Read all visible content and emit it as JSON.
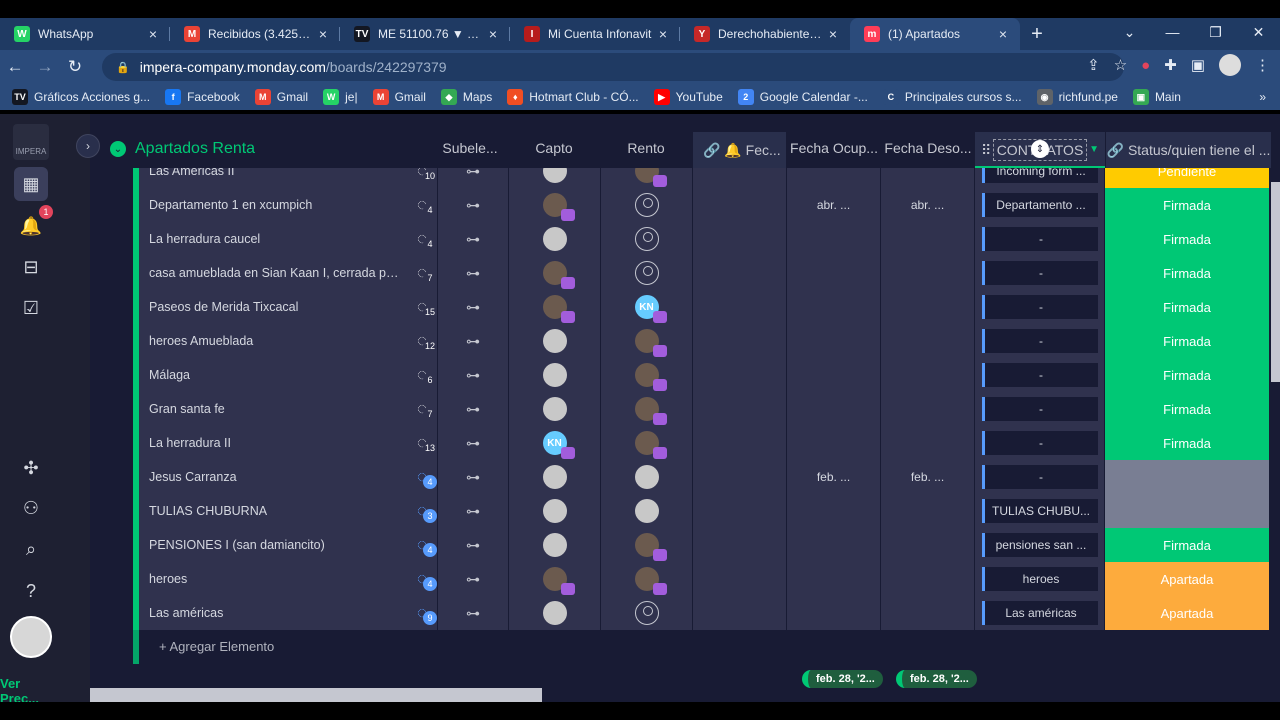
{
  "browser": {
    "tabs": [
      {
        "label": "WhatsApp",
        "icon": "whatsapp-icon",
        "color": "#25d366",
        "glyph": "W"
      },
      {
        "label": "Recibidos (3.425) - jor",
        "icon": "gmail-icon",
        "color": "#ea4335",
        "glyph": "M"
      },
      {
        "label": "ME 51100.76 ▼ −1.52",
        "icon": "tradingview-icon",
        "color": "#131722",
        "glyph": "TV"
      },
      {
        "label": "Mi Cuenta Infonavit",
        "icon": "infonavit-icon",
        "color": "#b71c1c",
        "glyph": "I"
      },
      {
        "label": "Derechohabientes | In",
        "icon": "infonavit-icon",
        "color": "#c62828",
        "glyph": "Y"
      },
      {
        "label": "(1) Apartados",
        "icon": "monday-icon",
        "color": "#ff3d57",
        "glyph": "m"
      }
    ],
    "url_host": "impera-company.monday.com",
    "url_path": "/boards/242297379",
    "bookmarks": [
      {
        "label": "Gráficos Acciones g...",
        "color": "#131722",
        "glyph": "TV"
      },
      {
        "label": "Facebook",
        "color": "#1877f2",
        "glyph": "f"
      },
      {
        "label": "Gmail",
        "color": "#ea4335",
        "glyph": "M"
      },
      {
        "label": "je|",
        "color": "#25d366",
        "glyph": "W"
      },
      {
        "label": "Gmail",
        "color": "#ea4335",
        "glyph": "M"
      },
      {
        "label": "Maps",
        "color": "#34a853",
        "glyph": "◆"
      },
      {
        "label": "Hotmart Club - CÓ...",
        "color": "#f04e23",
        "glyph": "♦"
      },
      {
        "label": "YouTube",
        "color": "#ff0000",
        "glyph": "▶"
      },
      {
        "label": "Google Calendar -...",
        "color": "#4285f4",
        "glyph": "2"
      },
      {
        "label": "Principales cursos s...",
        "color": "#2b4b7b",
        "glyph": "C"
      },
      {
        "label": "richfund.pe",
        "color": "#5f6368",
        "glyph": "◉"
      },
      {
        "label": "Main",
        "color": "#34a853",
        "glyph": "▣"
      }
    ]
  },
  "rail": {
    "logo_text": "IMPERA",
    "notif_count": "1",
    "ver_prec": "Ver Prec..."
  },
  "board": {
    "group_title": "Apartados Renta",
    "columns": {
      "subelementos": "Subele...",
      "capto": "Capto",
      "rento": "Rento",
      "fec": "Fec...",
      "fecha_ocup": "Fecha Ocup...",
      "fecha_deso": "Fecha Deso...",
      "contratos": "CONTRATOS",
      "status": "Status/quien tiene el ..."
    },
    "rows": [
      {
        "name": "Las Americas II",
        "updates": "10",
        "blue": false,
        "capto": "gray",
        "rento": "dark",
        "fecha_ocup": "",
        "fecha_deso": "",
        "contrato": "Incoming form ...",
        "status": "Pendiente",
        "status_class": "st-pendiente"
      },
      {
        "name": "Departamento 1 en xcumpich",
        "updates": "4",
        "blue": false,
        "capto": "dark",
        "rento": "empty",
        "fecha_ocup": "abr. ...",
        "fecha_deso": "abr. ...",
        "contrato": "Departamento ...",
        "status": "Firmada",
        "status_class": "st-firmada"
      },
      {
        "name": "La herradura caucel",
        "updates": "4",
        "blue": false,
        "capto": "gray",
        "rento": "empty",
        "fecha_ocup": "",
        "fecha_deso": "",
        "contrato": "-",
        "status": "Firmada",
        "status_class": "st-firmada"
      },
      {
        "name": "casa amueblada en Sian Kaan I, cerrada pa...",
        "updates": "7",
        "blue": false,
        "capto": "dark",
        "rento": "empty",
        "fecha_ocup": "",
        "fecha_deso": "",
        "contrato": "-",
        "status": "Firmada",
        "status_class": "st-firmada"
      },
      {
        "name": "Paseos de Merida Tixcacal",
        "updates": "15",
        "blue": false,
        "capto": "dark",
        "rento": "kn",
        "fecha_ocup": "",
        "fecha_deso": "",
        "contrato": "-",
        "status": "Firmada",
        "status_class": "st-firmada"
      },
      {
        "name": "heroes Amueblada",
        "updates": "12",
        "blue": false,
        "capto": "gray",
        "rento": "dark",
        "fecha_ocup": "",
        "fecha_deso": "",
        "contrato": "-",
        "status": "Firmada",
        "status_class": "st-firmada"
      },
      {
        "name": "Málaga",
        "updates": "6",
        "blue": false,
        "capto": "gray",
        "rento": "dark",
        "fecha_ocup": "",
        "fecha_deso": "",
        "contrato": "-",
        "status": "Firmada",
        "status_class": "st-firmada"
      },
      {
        "name": "Gran santa fe",
        "updates": "7",
        "blue": false,
        "capto": "gray",
        "rento": "dark",
        "fecha_ocup": "",
        "fecha_deso": "",
        "contrato": "-",
        "status": "Firmada",
        "status_class": "st-firmada"
      },
      {
        "name": "La herradura II",
        "updates": "13",
        "blue": false,
        "capto": "kn",
        "rento": "dark",
        "fecha_ocup": "",
        "fecha_deso": "",
        "contrato": "-",
        "status": "Firmada",
        "status_class": "st-firmada"
      },
      {
        "name": "Jesus Carranza",
        "updates": "4",
        "blue": true,
        "capto": "gray",
        "rento": "gray",
        "fecha_ocup": "feb. ...",
        "fecha_deso": "feb. ...",
        "contrato": "-",
        "status": "",
        "status_class": "st-empty"
      },
      {
        "name": "TULIAS CHUBURNA",
        "updates": "3",
        "blue": true,
        "capto": "gray",
        "rento": "gray",
        "fecha_ocup": "",
        "fecha_deso": "",
        "contrato": "TULIAS CHUBU...",
        "status": "",
        "status_class": "st-empty"
      },
      {
        "name": "PENSIONES I (san damiancito)",
        "updates": "4",
        "blue": true,
        "capto": "gray",
        "rento": "dark",
        "fecha_ocup": "",
        "fecha_deso": "",
        "contrato": "pensiones san ...",
        "status": "Firmada",
        "status_class": "st-firmada"
      },
      {
        "name": "heroes",
        "updates": "4",
        "blue": true,
        "capto": "dark",
        "rento": "dark",
        "fecha_ocup": "",
        "fecha_deso": "",
        "contrato": "heroes",
        "status": "Apartada",
        "status_class": "st-apartada"
      },
      {
        "name": "Las américas",
        "updates": "9",
        "blue": true,
        "capto": "gray",
        "rento": "empty",
        "fecha_ocup": "",
        "fecha_deso": "",
        "contrato": "Las américas",
        "status": "Apartada",
        "status_class": "st-apartada"
      }
    ],
    "add_item": "+ Agregar Elemento",
    "summary_pills": [
      "feb. 28, '2...",
      "feb. 28, '2..."
    ]
  },
  "colors": {
    "group_green": "#00c875",
    "firmada": "#00c875",
    "apartada": "#fdab3d",
    "pendiente": "#ffcb00",
    "board_bg": "#181b34",
    "cell_bg": "#30324e"
  }
}
